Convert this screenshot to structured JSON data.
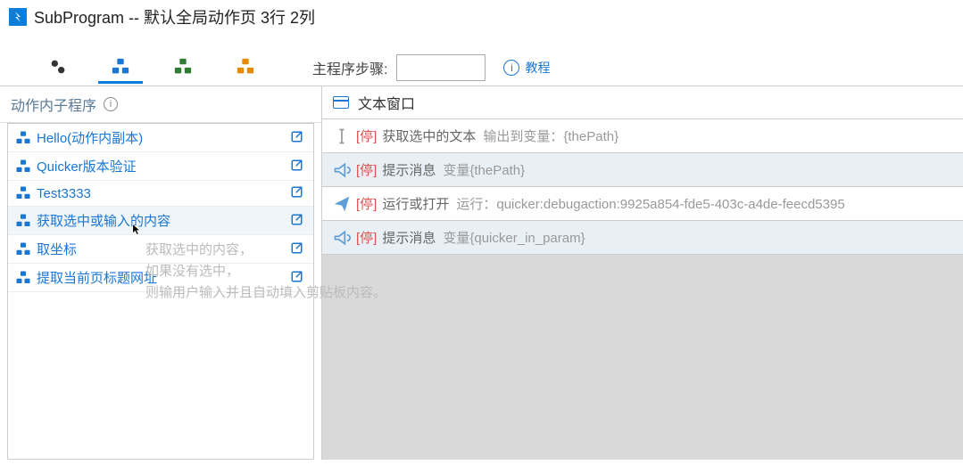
{
  "titlebar": {
    "title": "SubProgram -- 默认全局动作页 3行 2列"
  },
  "topbar": {
    "step_label": "主程序步骤:",
    "step_value": "",
    "tutorial_label": "教程"
  },
  "left": {
    "header": "动作内子程序",
    "items": [
      {
        "label": "Hello(动作内副本)"
      },
      {
        "label": "Quicker版本验证"
      },
      {
        "label": "Test3333"
      },
      {
        "label": "获取选中或输入的内容"
      },
      {
        "label": "取坐标"
      },
      {
        "label": "提取当前页标题网址"
      }
    ],
    "tooltip_line1": "获取选中的内容，",
    "tooltip_line2": "如果没有选中，",
    "tooltip_line3": "则输用户输入并且自动填入剪贴板内容。"
  },
  "right": {
    "header": "文本窗口",
    "steps": [
      {
        "stop": "[停]",
        "title": "获取选中的文本",
        "desc": "输出到变量：{thePath}",
        "icon": "cursor",
        "alt": false
      },
      {
        "stop": "[停]",
        "title": "提示消息",
        "desc": "变量{thePath}",
        "icon": "horn",
        "alt": true
      },
      {
        "stop": "[停]",
        "title": "运行或打开",
        "desc": "运行：quicker:debugaction:9925a854-fde5-403c-a4de-feecd5395",
        "icon": "plane",
        "alt": false
      },
      {
        "stop": "[停]",
        "title": "提示消息",
        "desc": "变量{quicker_in_param}",
        "icon": "horn",
        "alt": true
      }
    ]
  },
  "colors": {
    "accent": "#1976d2"
  }
}
